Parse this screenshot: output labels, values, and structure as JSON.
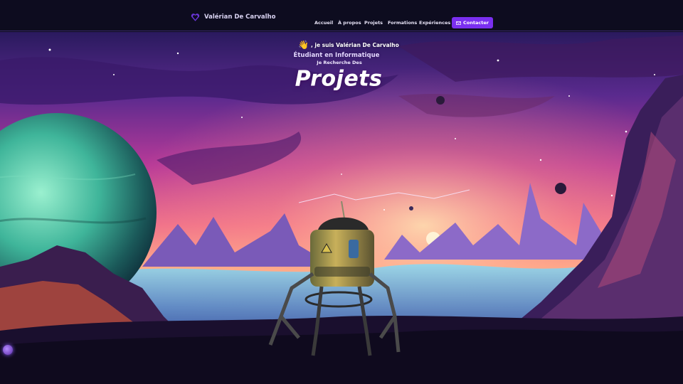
{
  "brand": {
    "name": "Valérian De Carvalho",
    "icon": "heart-shield-icon"
  },
  "nav": {
    "items": [
      {
        "label": "Accueil"
      },
      {
        "label": "À propos"
      },
      {
        "label": "Projets"
      },
      {
        "label": "Formations"
      },
      {
        "label": "Expériences"
      }
    ],
    "contact": {
      "label": "Contacter",
      "icon": "mail-icon"
    }
  },
  "hero": {
    "greeting": ", je suis Valérian De Carvalho",
    "wave_emoji": "👋",
    "role": "Étudiant en Informatique",
    "seeking": "Je Recherche Des",
    "word": "Projets"
  },
  "colors": {
    "accent": "#7a2ff0",
    "navbar": "#0d0c1f",
    "sky_top": "#3a1f7a",
    "sky_mid": "#c23a9a",
    "sky_glow": "#ffb07a"
  }
}
